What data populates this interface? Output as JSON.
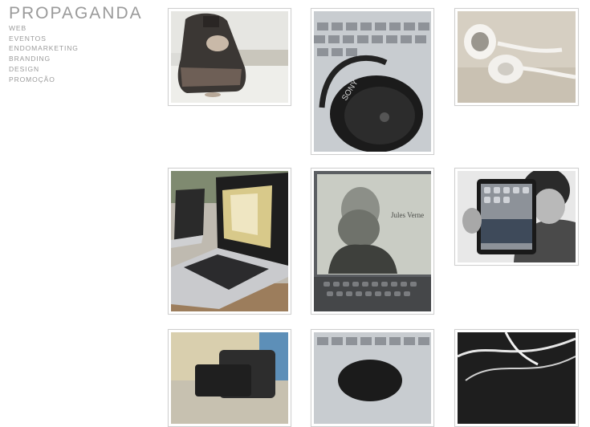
{
  "site": {
    "title": "PROPAGANDA"
  },
  "menu": {
    "items": [
      {
        "label": "WEB"
      },
      {
        "label": "EVENTOS"
      },
      {
        "label": "ENDOMARKETING"
      },
      {
        "label": "BRANDING"
      },
      {
        "label": "DESIGN"
      },
      {
        "label": "PROMOÇÃO"
      }
    ]
  },
  "gallery": {
    "photos": [
      {
        "subject": "woman-sitting-photo"
      },
      {
        "subject": "sony-headphones-photo",
        "caption": "SONY"
      },
      {
        "subject": "earphones-photo"
      },
      {
        "subject": "laptops-photo"
      },
      {
        "subject": "ebook-reader-photo",
        "caption": "Jules Verne"
      },
      {
        "subject": "tablet-photo"
      },
      {
        "subject": "banknotes-phone-photo"
      },
      {
        "subject": "keyboard-headphones-photo"
      },
      {
        "subject": "cables-photo"
      }
    ]
  },
  "colors": {
    "menu_text": "#9a9a9a",
    "frame_border": "#cfcfcf",
    "background": "#ffffff"
  }
}
